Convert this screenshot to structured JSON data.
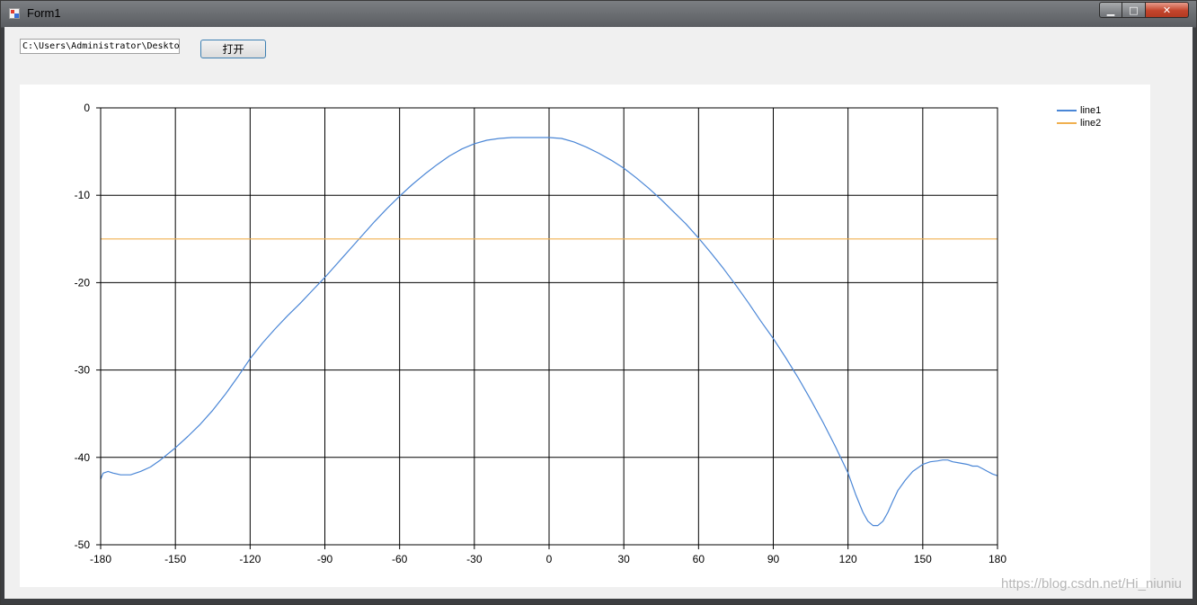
{
  "window": {
    "title": "Form1",
    "minimize_glyph": "▁",
    "maximize_glyph": "□",
    "close_glyph": "✕"
  },
  "toolbar": {
    "path_value": "C:\\Users\\Administrator\\Desktop\\",
    "open_label": "打开"
  },
  "watermark": "https://blog.csdn.net/Hi_niuniu",
  "chart_data": {
    "type": "line",
    "xlim": [
      -180,
      180
    ],
    "ylim": [
      -50,
      0
    ],
    "x_ticks": [
      -180,
      -150,
      -120,
      -90,
      -60,
      -30,
      0,
      30,
      60,
      90,
      120,
      150,
      180
    ],
    "y_ticks": [
      0,
      -10,
      -20,
      -30,
      -40,
      -50
    ],
    "grid": true,
    "legend_position": "top-right, outside plot",
    "series": [
      {
        "name": "line1",
        "color": "#4a86d6",
        "x": [
          -180,
          -179,
          -177,
          -175,
          -172,
          -168,
          -164,
          -160,
          -156,
          -150,
          -145,
          -140,
          -135,
          -130,
          -125,
          -120,
          -115,
          -110,
          -105,
          -100,
          -95,
          -90,
          -85,
          -80,
          -75,
          -70,
          -65,
          -60,
          -55,
          -50,
          -45,
          -40,
          -35,
          -30,
          -25,
          -20,
          -15,
          -10,
          -5,
          0,
          5,
          10,
          15,
          20,
          25,
          30,
          35,
          40,
          45,
          50,
          55,
          60,
          65,
          70,
          75,
          80,
          85,
          90,
          95,
          100,
          105,
          110,
          115,
          120,
          123,
          126,
          128,
          130,
          132,
          134,
          136,
          138,
          140,
          143,
          146,
          150,
          153,
          156,
          158,
          160,
          162,
          164,
          166,
          168,
          170,
          172,
          174,
          176,
          178,
          180
        ],
        "y": [
          -42.5,
          -41.8,
          -41.6,
          -41.8,
          -42.0,
          -42.0,
          -41.6,
          -41.1,
          -40.3,
          -38.9,
          -37.6,
          -36.2,
          -34.6,
          -32.8,
          -30.8,
          -28.7,
          -26.9,
          -25.3,
          -23.8,
          -22.4,
          -20.9,
          -19.4,
          -17.8,
          -16.2,
          -14.6,
          -13.0,
          -11.5,
          -10.1,
          -8.8,
          -7.6,
          -6.5,
          -5.5,
          -4.7,
          -4.1,
          -3.7,
          -3.5,
          -3.4,
          -3.4,
          -3.4,
          -3.4,
          -3.5,
          -3.9,
          -4.5,
          -5.2,
          -6.0,
          -6.9,
          -8.0,
          -9.2,
          -10.5,
          -11.9,
          -13.3,
          -14.9,
          -16.6,
          -18.4,
          -20.3,
          -22.3,
          -24.4,
          -26.4,
          -28.6,
          -30.9,
          -33.4,
          -36.0,
          -38.8,
          -41.8,
          -44.2,
          -46.3,
          -47.3,
          -47.8,
          -47.8,
          -47.3,
          -46.3,
          -45.0,
          -43.8,
          -42.6,
          -41.6,
          -40.8,
          -40.5,
          -40.4,
          -40.3,
          -40.3,
          -40.5,
          -40.6,
          -40.7,
          -40.8,
          -41.0,
          -41.0,
          -41.3,
          -41.6,
          -41.9,
          -42.1
        ]
      },
      {
        "name": "line2",
        "color": "#f0b050",
        "x": [
          -180,
          180
        ],
        "y": [
          -15,
          -15
        ]
      }
    ]
  }
}
